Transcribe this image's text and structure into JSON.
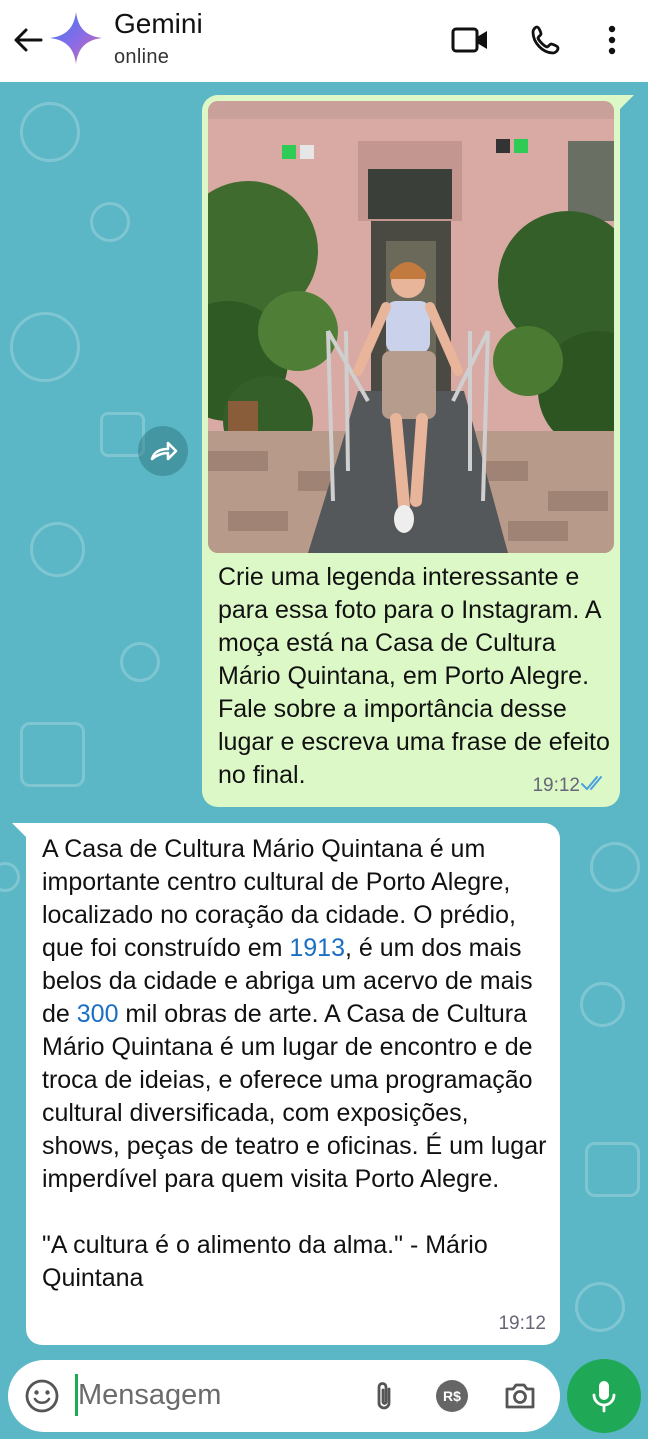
{
  "header": {
    "contact_name": "Gemini",
    "contact_status": "online",
    "icons": [
      "back-arrow-icon",
      "gemini-sparkle-icon",
      "video-call-icon",
      "voice-call-icon",
      "more-vert-icon"
    ]
  },
  "messages": {
    "outgoing": {
      "has_image": true,
      "image_description_icon": "photo-woman-at-cultural-house",
      "text": "Crie uma legenda interessante e para essa foto para o Instagram. A moça está na Casa de Cultura Mário Quintana, em Porto Alegre. Fale sobre a importância desse lugar e escreva uma frase de efeito no final.",
      "time": "19:12",
      "status": "read"
    },
    "incoming": {
      "text_part1": "A Casa de Cultura Mário Quintana é um importante centro cultural de Porto Alegre, localizado no coração da cidade. O prédio, que foi construído em ",
      "year": "1913",
      "text_part2": ", é um dos mais belos da cidade e abriga um acervo de mais de ",
      "count": "300",
      "text_part3": " mil obras de arte. A Casa de Cultura Mário Quintana é um lugar de encontro e de troca de ideias, e oferece uma programação cultural diversificada, com exposições, shows, peças de teatro e oficinas. É um lugar imperdível para quem visita Porto Alegre.",
      "quote": "\"A cultura é o alimento da alma.\" - Mário Quintana",
      "time": "19:12"
    }
  },
  "composer": {
    "placeholder": "Mensagem",
    "value": "",
    "currency_label": "R$"
  },
  "colors": {
    "wallpaper": "#5bb7c6",
    "outgoing_bubble": "#dcf8c6",
    "incoming_bubble": "#ffffff",
    "accent_green": "#1fa855",
    "read_ticks": "#4a9fe0",
    "link": "#1b6fc2"
  }
}
